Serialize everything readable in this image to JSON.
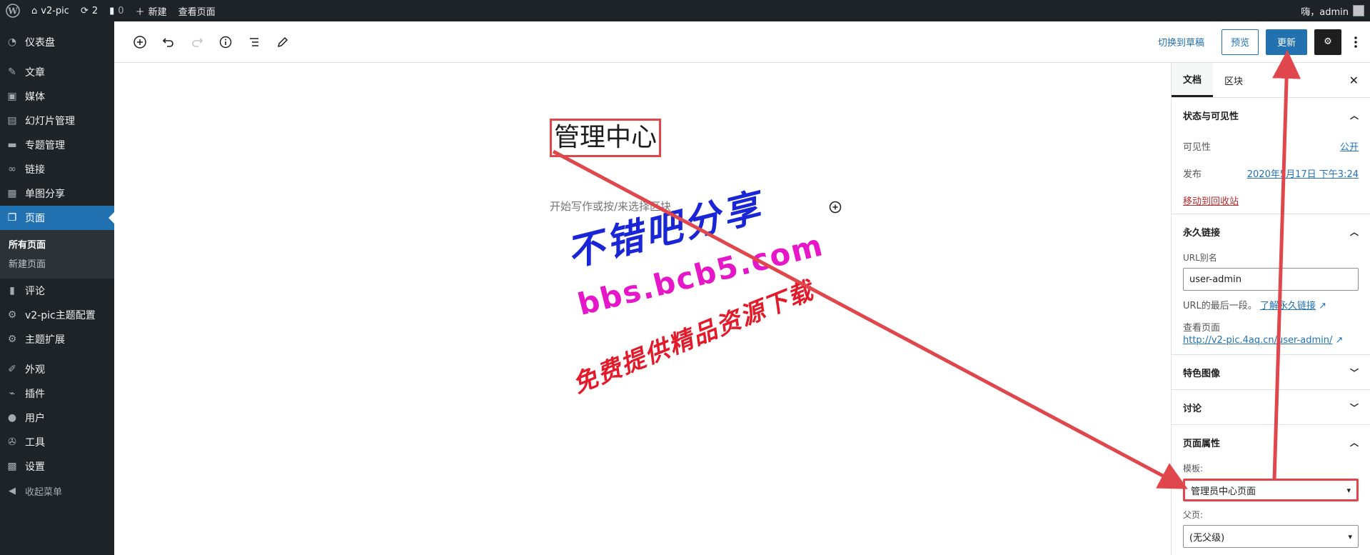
{
  "adminbar": {
    "site_name": "v2-pic",
    "updates_count": "2",
    "comments_count": "0",
    "new_label": "新建",
    "view_page_label": "查看页面",
    "greeting": "嗨，admin"
  },
  "sidebar": {
    "items": [
      {
        "label": "仪表盘",
        "icon": "dashboard-icon"
      },
      {
        "label": "文章",
        "icon": "pin-icon"
      },
      {
        "label": "媒体",
        "icon": "media-icon"
      },
      {
        "label": "幻灯片管理",
        "icon": "images-icon"
      },
      {
        "label": "专题管理",
        "icon": "folder-icon"
      },
      {
        "label": "链接",
        "icon": "link-icon"
      },
      {
        "label": "单图分享",
        "icon": "image-icon"
      },
      {
        "label": "页面",
        "icon": "page-icon"
      },
      {
        "label": "评论",
        "icon": "comment-icon"
      },
      {
        "label": "v2-pic主题配置",
        "icon": "gear-icon"
      },
      {
        "label": "主题扩展",
        "icon": "gear-icon"
      },
      {
        "label": "外观",
        "icon": "brush-icon"
      },
      {
        "label": "插件",
        "icon": "plugin-icon"
      },
      {
        "label": "用户",
        "icon": "user-icon"
      },
      {
        "label": "工具",
        "icon": "wrench-icon"
      },
      {
        "label": "设置",
        "icon": "settings-icon"
      }
    ],
    "submenu": {
      "all_pages": "所有页面",
      "new_page": "新建页面"
    },
    "collapse_label": "收起菜单"
  },
  "toolbar": {
    "switch_draft": "切换到草稿",
    "preview": "预览",
    "update": "更新"
  },
  "editor": {
    "title": "管理中心",
    "placeholder": "开始写作或按/来选择区块"
  },
  "watermark": {
    "line1": "不错吧分享",
    "line2": "bbs.bcb5.com",
    "line3": "免费提供精品资源下载"
  },
  "panel": {
    "tabs": {
      "document": "文档",
      "block": "区块"
    },
    "status": {
      "heading": "状态与可见性",
      "visibility_label": "可见性",
      "visibility_value": "公开",
      "publish_label": "发布",
      "publish_value": "2020年5月17日 下午3:24",
      "trash": "移动到回收站"
    },
    "permalink": {
      "heading": "永久链接",
      "slug_label": "URL别名",
      "slug_value": "user-admin",
      "help_text": "URL的最后一段。",
      "help_link": "了解永久链接",
      "view_label": "查看页面",
      "view_url": "http://v2-pic.4aq.cn/user-admin/"
    },
    "featured_image": "特色图像",
    "discussion": "讨论",
    "page_attributes": {
      "heading": "页面属性",
      "template_label": "模板:",
      "template_value": "管理员中心页面",
      "parent_label": "父页:",
      "parent_value": "(无父级)"
    }
  },
  "colors": {
    "accent": "#2271b1",
    "admin_dark": "#1d2327",
    "annotation_red": "#e0474c"
  }
}
